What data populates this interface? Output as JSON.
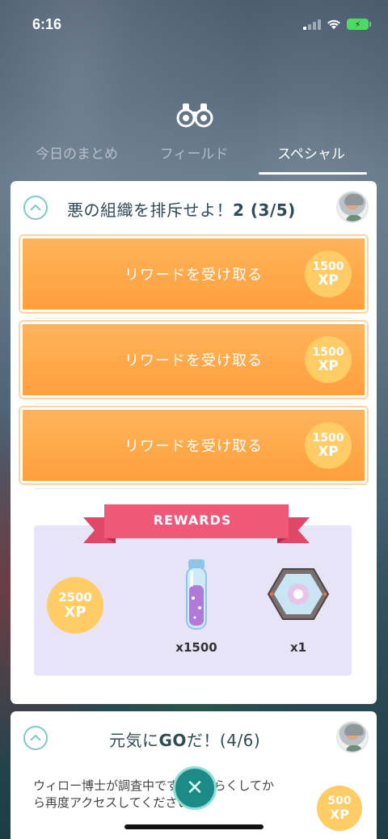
{
  "status": {
    "time": "6:16"
  },
  "tabs": [
    {
      "label": "今日のまとめ",
      "active": false
    },
    {
      "label": "フィールド",
      "active": false
    },
    {
      "label": "スペシャル",
      "active": true
    }
  ],
  "quest1": {
    "title": "悪の組織を排斥せよ！",
    "progress": "2 (3/5)",
    "rewards_buttons": [
      {
        "label": "リワードを受け取る",
        "xp_value": "1500",
        "xp_unit": "XP"
      },
      {
        "label": "リワードを受け取る",
        "xp_value": "1500",
        "xp_unit": "XP"
      },
      {
        "label": "リワードを受け取る",
        "xp_value": "1500",
        "xp_unit": "XP"
      }
    ],
    "rewards_banner": "REWARDS",
    "rewards": {
      "xp_value": "2500",
      "xp_unit": "XP",
      "stardust_count": "x1500",
      "incubator_count": "x1"
    }
  },
  "quest2": {
    "title_part1": "元気に",
    "title_part2": "GO",
    "title_part3": "だ！(4/6)",
    "text": "ウィロー博士が調査中です。しばらくしてから再度アクセスしてください。",
    "xp_value": "500",
    "xp_unit": "XP"
  },
  "colors": {
    "accent_orange": "#ff9f3d",
    "teal": "#1c8a86",
    "ribbon_pink": "#f0587a",
    "xp_gold": "#ffcc66"
  }
}
